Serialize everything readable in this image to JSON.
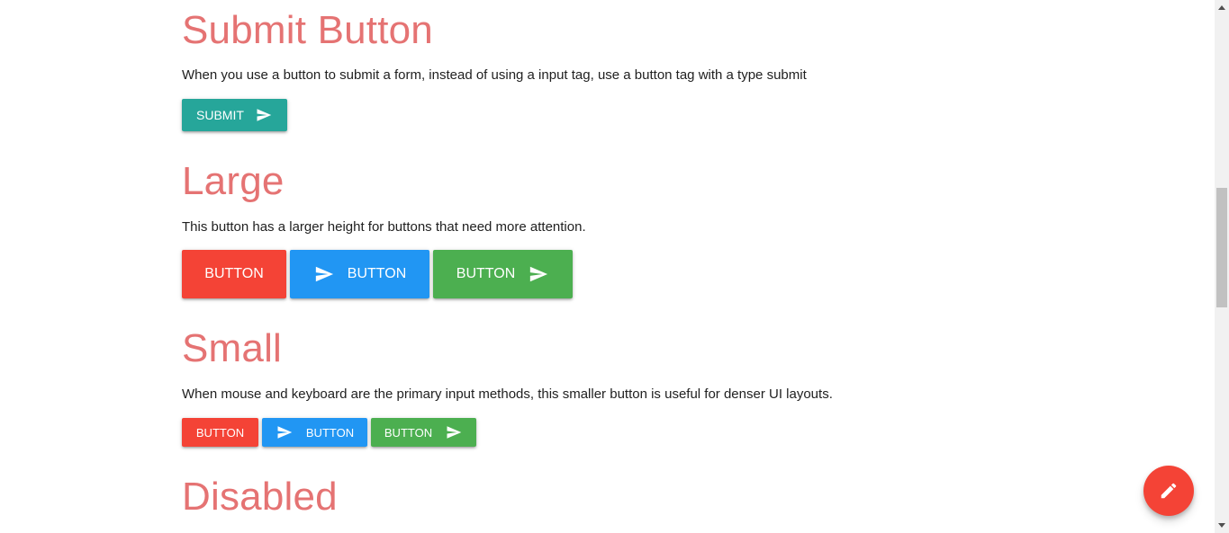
{
  "sections": {
    "submit": {
      "title": "Submit Button",
      "description": "When you use a button to submit a form, instead of using a input tag, use a button tag with a type submit",
      "button": {
        "label": "SUBMIT",
        "icon": "send-icon",
        "color": "#26a69a"
      }
    },
    "large": {
      "title": "Large",
      "description": "This button has a larger height for buttons that need more attention.",
      "buttons": [
        {
          "label": "BUTTON",
          "icon": null,
          "color": "#f44336"
        },
        {
          "label": "BUTTON",
          "icon": "send-icon",
          "icon_position": "left",
          "color": "#2196f3"
        },
        {
          "label": "BUTTON",
          "icon": "send-icon",
          "icon_position": "right",
          "color": "#4caf50"
        }
      ]
    },
    "small": {
      "title": "Small",
      "description": "When mouse and keyboard are the primary input methods, this smaller button is useful for denser UI layouts.",
      "buttons": [
        {
          "label": "BUTTON",
          "icon": null,
          "color": "#f44336"
        },
        {
          "label": "BUTTON",
          "icon": "send-icon",
          "icon_position": "left",
          "color": "#2196f3"
        },
        {
          "label": "BUTTON",
          "icon": "send-icon",
          "icon_position": "right",
          "color": "#4caf50"
        }
      ]
    },
    "disabled": {
      "title": "Disabled"
    }
  },
  "fab": {
    "icon": "pencil-icon",
    "color": "#f44336"
  },
  "theme": {
    "heading_color": "#e57373"
  }
}
